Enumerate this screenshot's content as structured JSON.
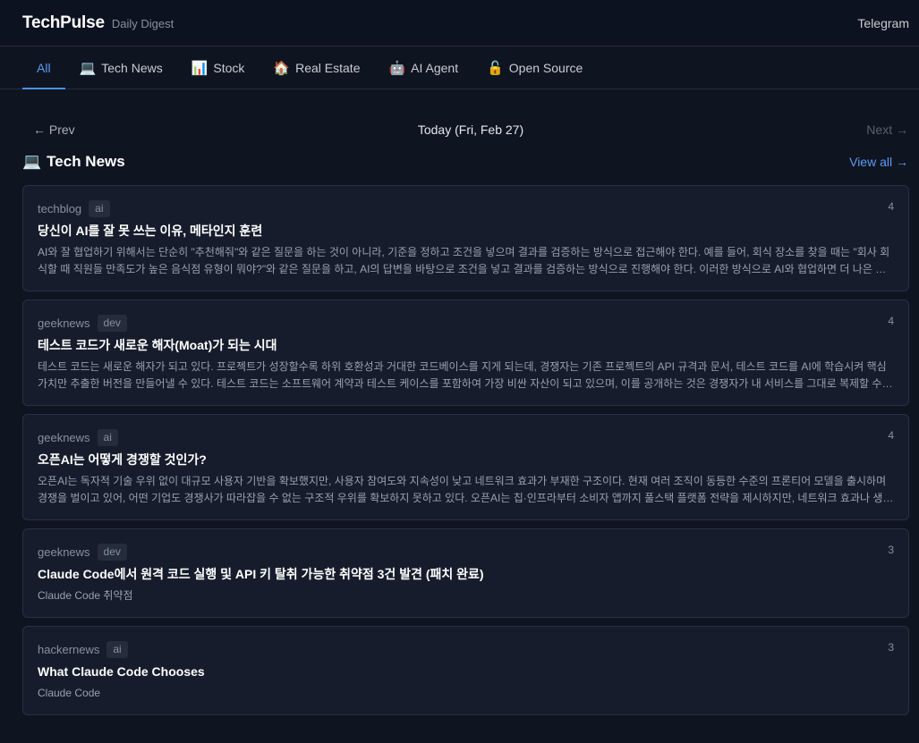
{
  "header": {
    "brand": "TechPulse",
    "subtitle": "Daily Digest",
    "telegram_label": "Telegram"
  },
  "tabs": [
    {
      "label": "All",
      "icon": "",
      "icon_name": ""
    },
    {
      "label": "Tech News",
      "icon": "💻",
      "icon_name": "laptop-icon"
    },
    {
      "label": "Stock",
      "icon": "📊",
      "icon_name": "bar-chart-icon"
    },
    {
      "label": "Real Estate",
      "icon": "🏠",
      "icon_name": "house-icon"
    },
    {
      "label": "AI Agent",
      "icon": "🤖",
      "icon_name": "robot-icon"
    },
    {
      "label": "Open Source",
      "icon": "🔓",
      "icon_name": "unlock-icon"
    }
  ],
  "date_nav": {
    "prev_label": "← Prev",
    "date_label": "Today (Fri, Feb 27)",
    "next_label": "Next →"
  },
  "section": {
    "icon": "💻",
    "title": "Tech News",
    "view_all_label": "View all →"
  },
  "colors": {
    "accent": "#5b9cf7",
    "background": "#0f1421",
    "card_background": "#161c2b"
  },
  "articles": [
    {
      "source": "techblog",
      "tag": "ai",
      "score": "4",
      "title": "당신이 AI를 잘 못 쓰는 이유, 메타인지 훈련",
      "summary": "AI와 잘 협업하기 위해서는 단순히 \"추천해줘\"와 같은 질문을 하는 것이 아니라, 기준을 정하고 조건을 넣으며 결과를 검증하는 방식으로 접근해야 한다. 예를 들어, 회식 장소를 찾을 때는 \"회사 회식할 때 직원들 만족도가 높은 음식점 유형이 뭐야?\"와 같은 질문을 하고, AI의 답변을 바탕으로 조건을 넣고 결과를 검증하는 방식으로 진행해야 한다. 이러한 방식으로 AI와 협업하면 더 나은 결과를 얻을 ..."
    },
    {
      "source": "geeknews",
      "tag": "dev",
      "score": "4",
      "title": "테스트 코드가 새로운 해자(Moat)가 되는 시대",
      "summary": "테스트 코드는 새로운 해자가 되고 있다. 프로젝트가 성장할수록 하위 호환성과 거대한 코드베이스를 지게 되는데, 경쟁자는 기존 프로젝트의 API 규격과 문서, 테스트 코드를 AI에 학습시켜 핵심 가치만 추출한 버전을 만들어낼 수 있다. 테스트 코드는 소프트웨어 계약과 테스트 케이스를 포함하여 가장 비싼 자산이 되고 있으며, 이를 공개하는 것은 경쟁자가 내 서비스를 그대로 복제할 수 있는 정밀한 ..."
    },
    {
      "source": "geeknews",
      "tag": "ai",
      "score": "4",
      "title": "오픈AI는 어떻게 경쟁할 것인가?",
      "summary": "오픈AI는 독자적 기술 우위 없이 대규모 사용자 기반을 확보했지만, 사용자 참여도와 지속성이 낮고 네트워크 효과가 부재한 구조이다. 현재 여러 조직이 동등한 수준의 프론티어 모델을 출시하며 경쟁을 벌이고 있어, 어떤 기업도 경쟁사가 따라잡을 수 없는 구조적 우위를 확보하지 못하고 있다. 오픈AI는 칩·인프라부터 소비자 앱까지 풀스택 플랫폼 전략을 제시하지만, 네트워크 효과나 생태계 잠금 효..."
    },
    {
      "source": "geeknews",
      "tag": "dev",
      "score": "3",
      "title": "Claude Code에서 원격 코드 실행 및 API 키 탈취 가능한 취약점 3건 발견 (패치 완료)",
      "summary": "Claude Code 취약점"
    },
    {
      "source": "hackernews",
      "tag": "ai",
      "score": "3",
      "title": "What Claude Code Chooses",
      "summary": "Claude Code"
    }
  ]
}
